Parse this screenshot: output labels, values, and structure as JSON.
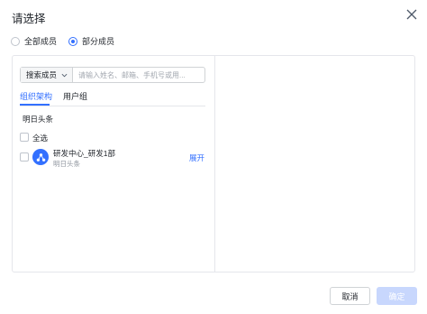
{
  "dialog": {
    "title": "请选择",
    "close_icon": "close-icon"
  },
  "scope": {
    "options": [
      "全部成员",
      "部分成员"
    ],
    "selected": "部分成员"
  },
  "search": {
    "type_label": "搜索成员",
    "placeholder": "请输入姓名、邮箱、手机号或用..."
  },
  "tabs": [
    {
      "label": "组织架构",
      "active": true
    },
    {
      "label": "用户组",
      "active": false
    }
  ],
  "breadcrumb": "明日头条",
  "select_all_label": "全选",
  "departments": [
    {
      "name": "研发中心_研发1部",
      "sub": "明日头条",
      "action": "展开"
    }
  ],
  "footer": {
    "cancel_label": "取消",
    "confirm_label": "确定"
  },
  "colors": {
    "accent": "#3370ff",
    "confirm_disabled": "#c8d7fd",
    "border": "#e5e6eb"
  }
}
